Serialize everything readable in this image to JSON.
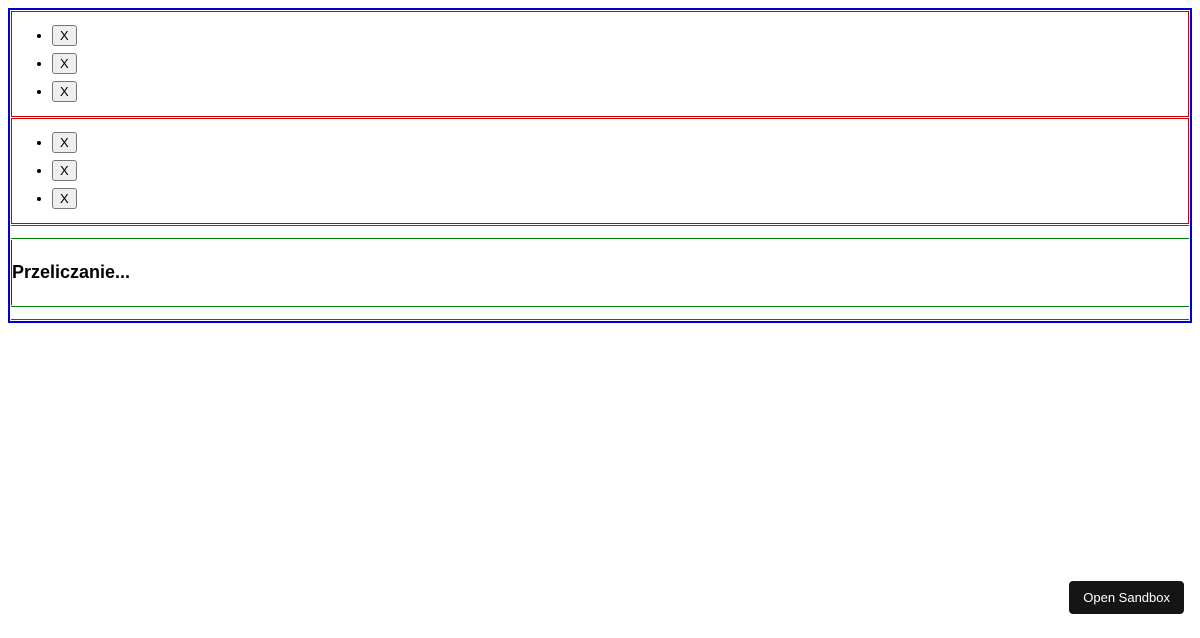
{
  "lists": [
    {
      "items": [
        "X",
        "X",
        "X"
      ]
    },
    {
      "items": [
        "X",
        "X",
        "X"
      ]
    }
  ],
  "status": {
    "heading": "Przeliczanie..."
  },
  "sandbox": {
    "button_label": "Open Sandbox"
  }
}
